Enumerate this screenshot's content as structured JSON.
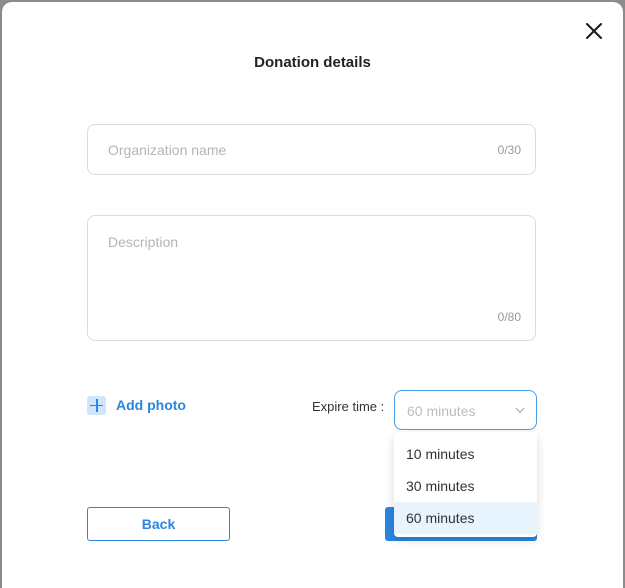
{
  "dialog": {
    "title": "Donation details"
  },
  "organization_field": {
    "placeholder": "Organization name",
    "value": "",
    "counter": "0/30"
  },
  "description_field": {
    "placeholder": "Description",
    "value": "",
    "counter": "0/80"
  },
  "add_photo": {
    "label": "Add photo",
    "icon": "plus-icon"
  },
  "expire": {
    "label": "Expire time :",
    "selected_value": "60 minutes",
    "options": [
      "10 minutes",
      "30 minutes",
      "60 minutes"
    ],
    "highlighted_option": "60 minutes"
  },
  "footer": {
    "back_label": "Back"
  },
  "icons": {
    "close": "close-icon",
    "chevron": "chevron-down-icon"
  },
  "colors": {
    "accent": "#2a86e0",
    "option_highlight": "#e8f4fd"
  }
}
